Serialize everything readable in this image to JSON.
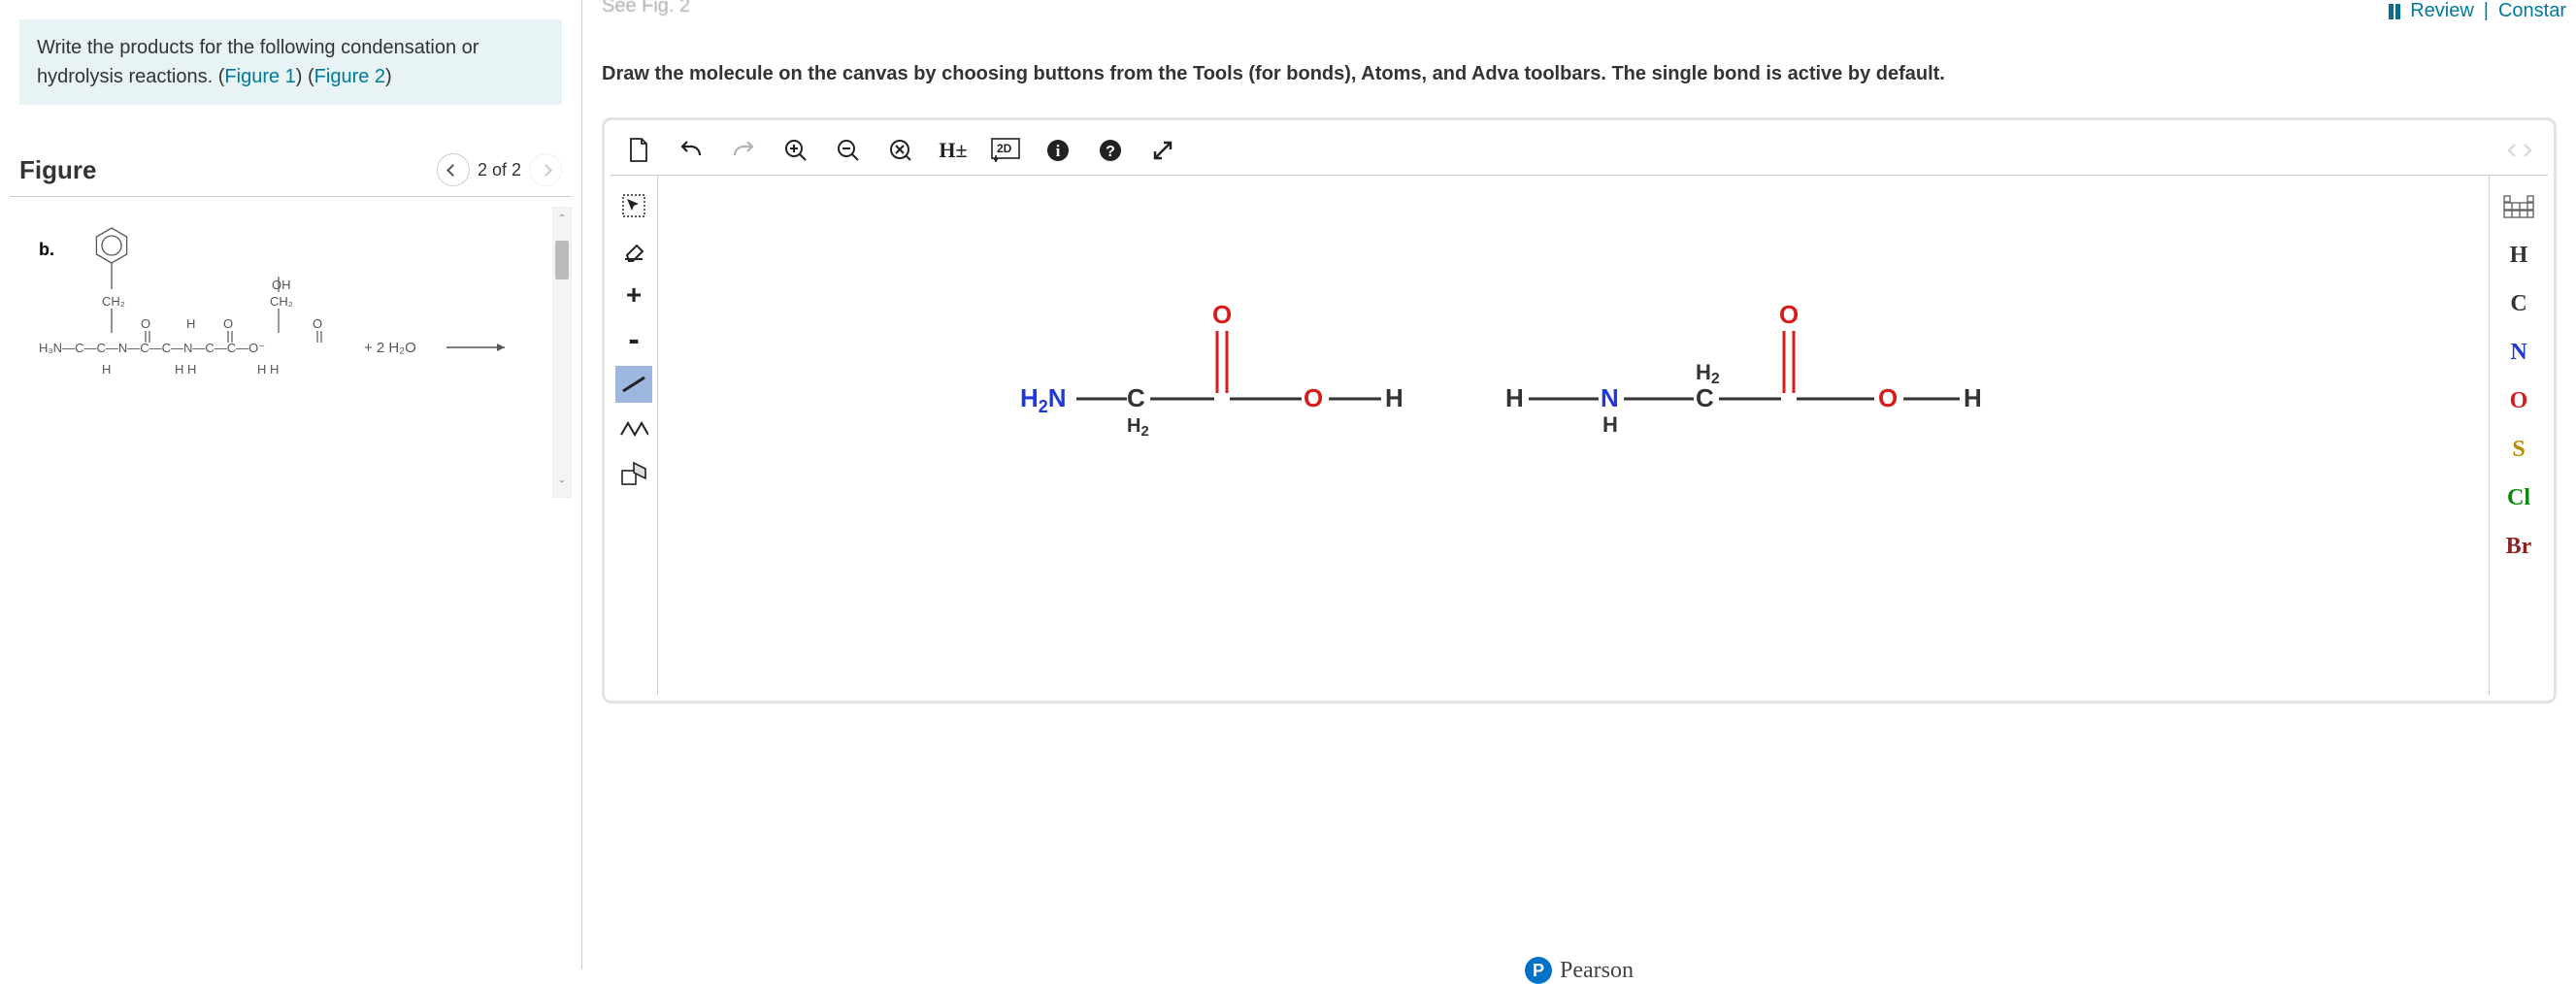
{
  "left": {
    "prompt_prefix": "Write the products for the following condensation or hydrolysis reactions. (",
    "fig1": "Figure 1",
    "mid": ") (",
    "fig2": "Figure 2",
    "suffix": ")",
    "figure_title": "Figure",
    "page_label": "2 of 2",
    "reaction_label_b": "b.",
    "reaction_plus": "+  2 H₂O",
    "figure_atoms": {
      "h3n": "H₃N",
      "ch2": "CH₂",
      "oh": "OH",
      "o": "O",
      "h": "H",
      "n": "N",
      "c": "C",
      "ominus": "O⁻"
    }
  },
  "right": {
    "top_cutoff": "See Fig. 2",
    "review_link": "Review",
    "constants_link": "Constar",
    "instructions": "Draw the molecule on the canvas by choosing buttons from the Tools (for bonds), Atoms, and Adva toolbars. The single bond is active by default.",
    "top_tools": {
      "new": "new",
      "undo": "undo",
      "redo": "redo",
      "zoom_in": "zoom-in",
      "zoom_out": "zoom-out",
      "delete": "delete",
      "h_toggle": "H±",
      "view2d": "2D",
      "info": "info",
      "help": "help",
      "fullscreen": "fullscreen",
      "nav": "nav"
    },
    "left_tools": {
      "select": "select",
      "erase": "erase",
      "charge_plus": "+",
      "charge_minus": "-",
      "single_bond": "single-bond",
      "chain": "chain",
      "template": "template"
    },
    "right_tools": {
      "periodic": "periodic",
      "atoms": [
        "H",
        "C",
        "N",
        "O",
        "S",
        "Cl",
        "Br"
      ]
    },
    "pearson": "Pearson",
    "canvas_molecules": [
      {
        "parts": [
          "H₂N",
          "C",
          "O",
          "O",
          "H"
        ],
        "bridge": "H₂"
      },
      {
        "parts": [
          "H",
          "N",
          "C",
          "O",
          "O",
          "H"
        ],
        "bridge_h2": "H₂",
        "nh": "H"
      }
    ]
  }
}
